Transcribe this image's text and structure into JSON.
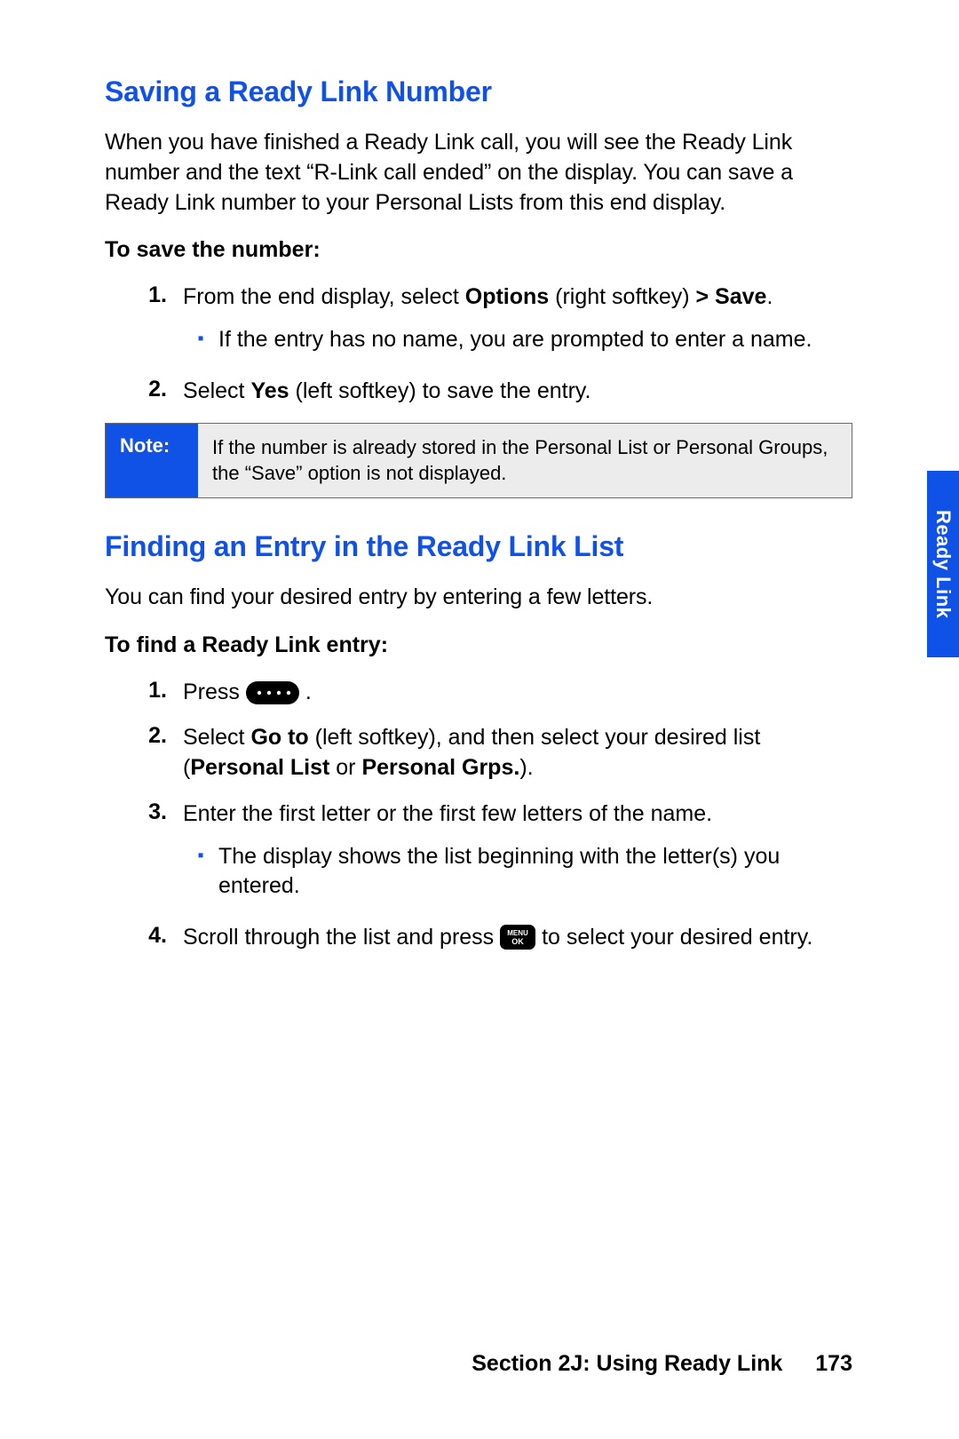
{
  "section1": {
    "heading": "Saving a Ready Link Number",
    "intro": "When you have finished a Ready Link call, you will see the Ready Link number and the text “R-Link call ended” on the display. You can save a Ready Link number to your Personal Lists from this end display.",
    "subhead": "To save the number:",
    "step1_a": "From the end display, select ",
    "step1_b": "Options",
    "step1_c": " (right softkey) ",
    "step1_d": "> Save",
    "step1_e": ".",
    "bullet1": "If the entry has no name, you are prompted to enter a name.",
    "step2_a": "Select ",
    "step2_b": "Yes",
    "step2_c": " (left softkey) to save the entry."
  },
  "note": {
    "label": "Note:",
    "text": "If the number is already stored in the Personal List or Personal Groups, the “Save” option is not displayed."
  },
  "section2": {
    "heading": "Finding an Entry in the Ready Link List",
    "intro": "You can find your desired entry by entering a few letters.",
    "subhead": "To find a Ready Link entry:",
    "step1_a": "Press ",
    "step1_b": ".",
    "step2_a": "Select ",
    "step2_b": "Go to",
    "step2_c": " (left softkey), and then select your desired list (",
    "step2_d": "Personal List",
    "step2_e": " or ",
    "step2_f": "Personal Grps.",
    "step2_g": ").",
    "step3": "Enter the first letter or the first few letters of the name.",
    "bullet3": "The display shows the list beginning with the letter(s) you entered.",
    "step4_a": "Scroll through the list and press ",
    "step4_b": " to select your desired entry."
  },
  "nums": {
    "n1": "1.",
    "n2": "2.",
    "n3": "3.",
    "n4": "4."
  },
  "tab": "Ready Link",
  "footer": {
    "section": "Section 2J: Using Ready Link",
    "page": "173"
  }
}
